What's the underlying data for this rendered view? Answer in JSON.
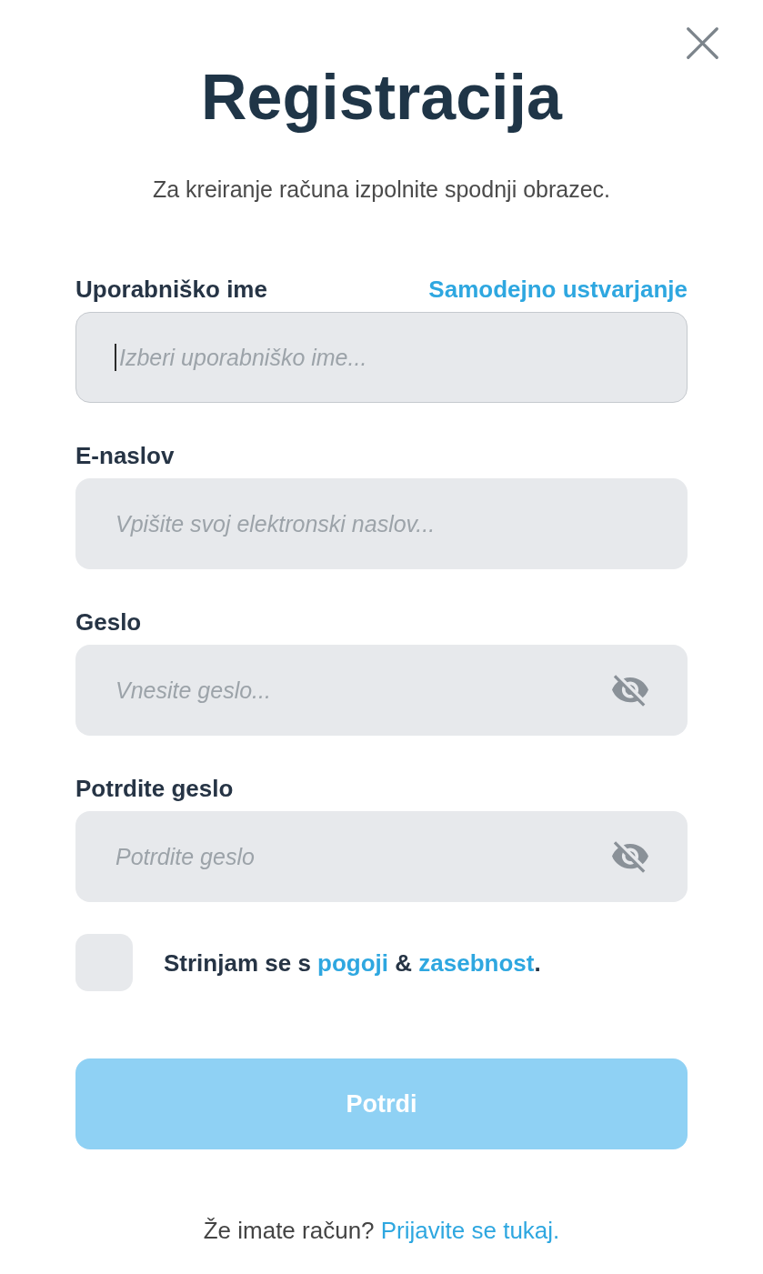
{
  "title": "Registracija",
  "subtitle": "Za kreiranje računa izpolnite spodnji obrazec.",
  "fields": [
    {
      "kind": "text",
      "label": "Uporabniško ime",
      "action": "Samodejno ustvarjanje",
      "placeholder": "Izberi uporabniško ime...",
      "focused": true
    },
    {
      "kind": "text",
      "label": "E-naslov",
      "placeholder": "Vpišite svoj elektronski naslov...",
      "focused": false
    },
    {
      "kind": "password",
      "label": "Geslo",
      "placeholder": "Vnesite geslo...",
      "focused": false
    },
    {
      "kind": "password",
      "label": "Potrdite geslo",
      "placeholder": "Potrdite geslo",
      "focused": false
    }
  ],
  "agreement": {
    "checked": false,
    "parts": [
      {
        "kind": "text",
        "text": "Strinjam se s "
      },
      {
        "kind": "link",
        "text": "pogoji"
      },
      {
        "kind": "text",
        "text": " & "
      },
      {
        "kind": "link",
        "text": "zasebnost"
      },
      {
        "kind": "text",
        "text": "."
      }
    ]
  },
  "submit": {
    "label": "Potrdi",
    "disabled": true
  },
  "footer": {
    "parts": [
      {
        "kind": "text",
        "text": "Že imate račun? "
      },
      {
        "kind": "link",
        "text": "Prijavite se tukaj."
      }
    ]
  }
}
